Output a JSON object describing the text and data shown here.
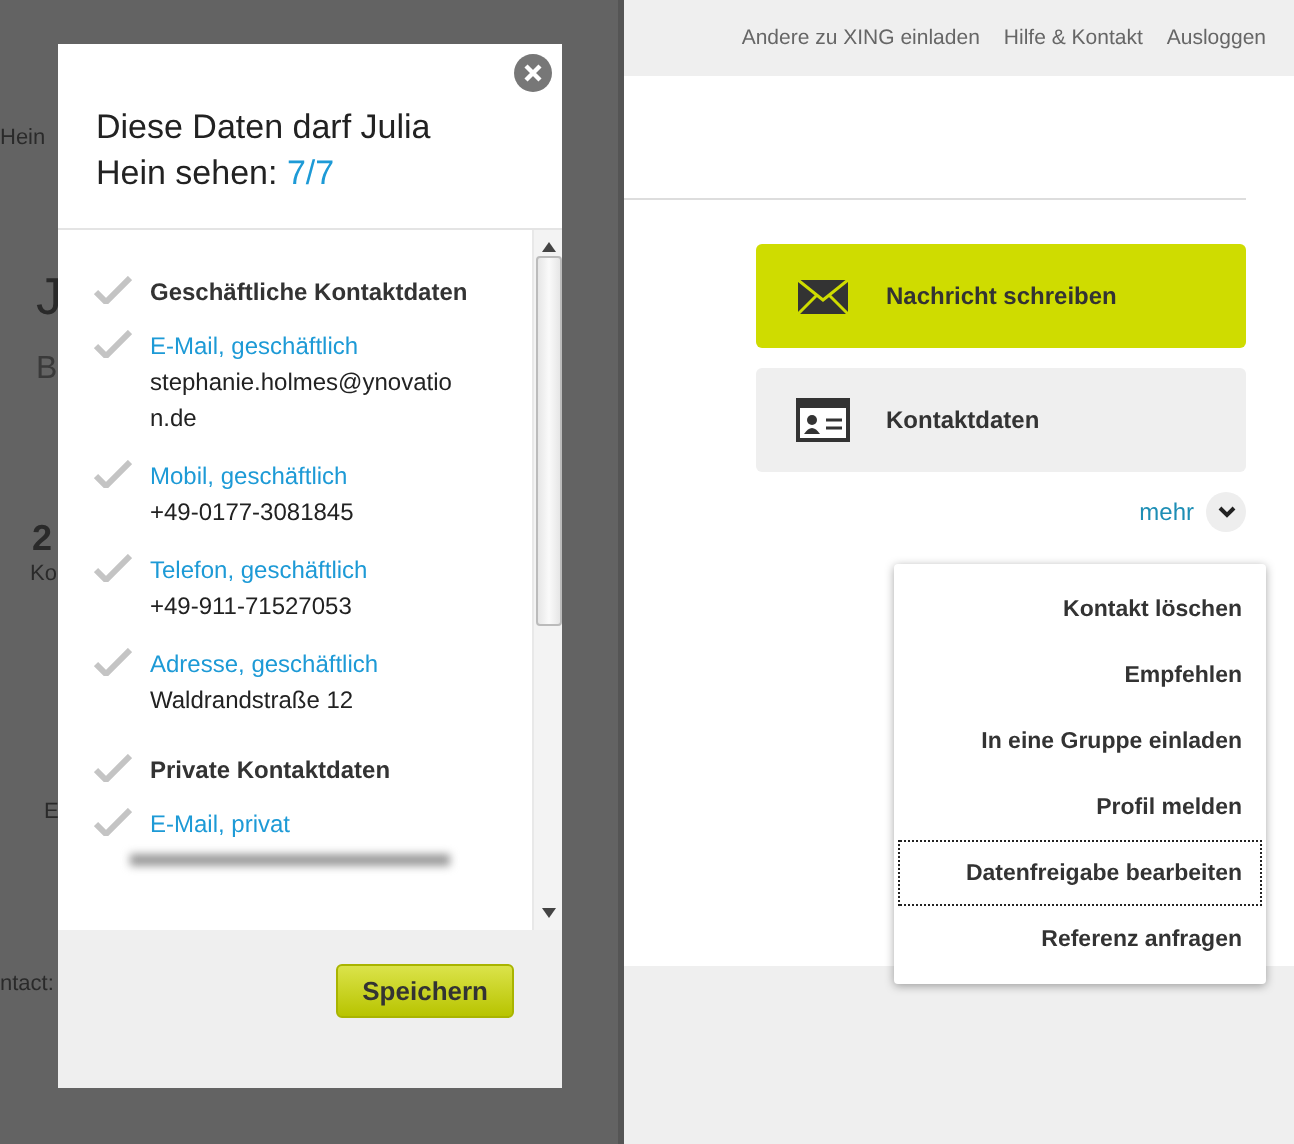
{
  "top_links": [
    "Andere zu XING einladen",
    "Hilfe & Kontakt",
    "Ausloggen"
  ],
  "background_fragments": [
    {
      "kind": "small",
      "text": "Hein"
    },
    {
      "kind": "large",
      "text": "J"
    },
    {
      "kind": "medium",
      "text": "B"
    },
    {
      "kind": "bold",
      "text": "2"
    },
    {
      "kind": "small",
      "text": "Ko"
    },
    {
      "kind": "small",
      "text": "E"
    },
    {
      "kind": "small",
      "text": "ntact:"
    }
  ],
  "actions": [
    {
      "kind": "primary",
      "label": "Nachricht schreiben"
    },
    {
      "kind": "secondary",
      "label": "Kontaktdaten"
    }
  ],
  "more": {
    "label": "mehr",
    "expanded": true
  },
  "menu": [
    {
      "label": "Kontakt löschen",
      "selected": false
    },
    {
      "label": "Empfehlen",
      "selected": false
    },
    {
      "label": "In eine Gruppe einladen",
      "selected": false
    },
    {
      "label": "Profil melden",
      "selected": false
    },
    {
      "label": "Datenfreigabe bearbeiten",
      "selected": true
    },
    {
      "label": "Referenz anfragen",
      "selected": false
    }
  ],
  "dialog": {
    "title": "Diese Daten darf Julia Hein sehen: ",
    "count": "7/7",
    "items": [
      {
        "kind": "section",
        "label": "Geschäftliche Kontaktdaten",
        "checked": true
      },
      {
        "kind": "field",
        "label": "E-Mail, geschäftlich",
        "value": "stephanie.holmes@ynovation.de",
        "checked": true
      },
      {
        "kind": "field",
        "label": "Mobil, geschäftlich",
        "value": "+49-0177-3081845",
        "checked": true
      },
      {
        "kind": "field",
        "label": "Telefon, geschäftlich",
        "value": "+49-911-71527053",
        "checked": true
      },
      {
        "kind": "field",
        "label": "Adresse, geschäftlich",
        "value": "Waldrandstraße 12",
        "checked": true
      },
      {
        "kind": "section",
        "label": "Private Kontaktdaten",
        "checked": true
      },
      {
        "kind": "redacted",
        "label": "E-Mail, privat",
        "checked": true
      }
    ],
    "save": "Speichern"
  }
}
